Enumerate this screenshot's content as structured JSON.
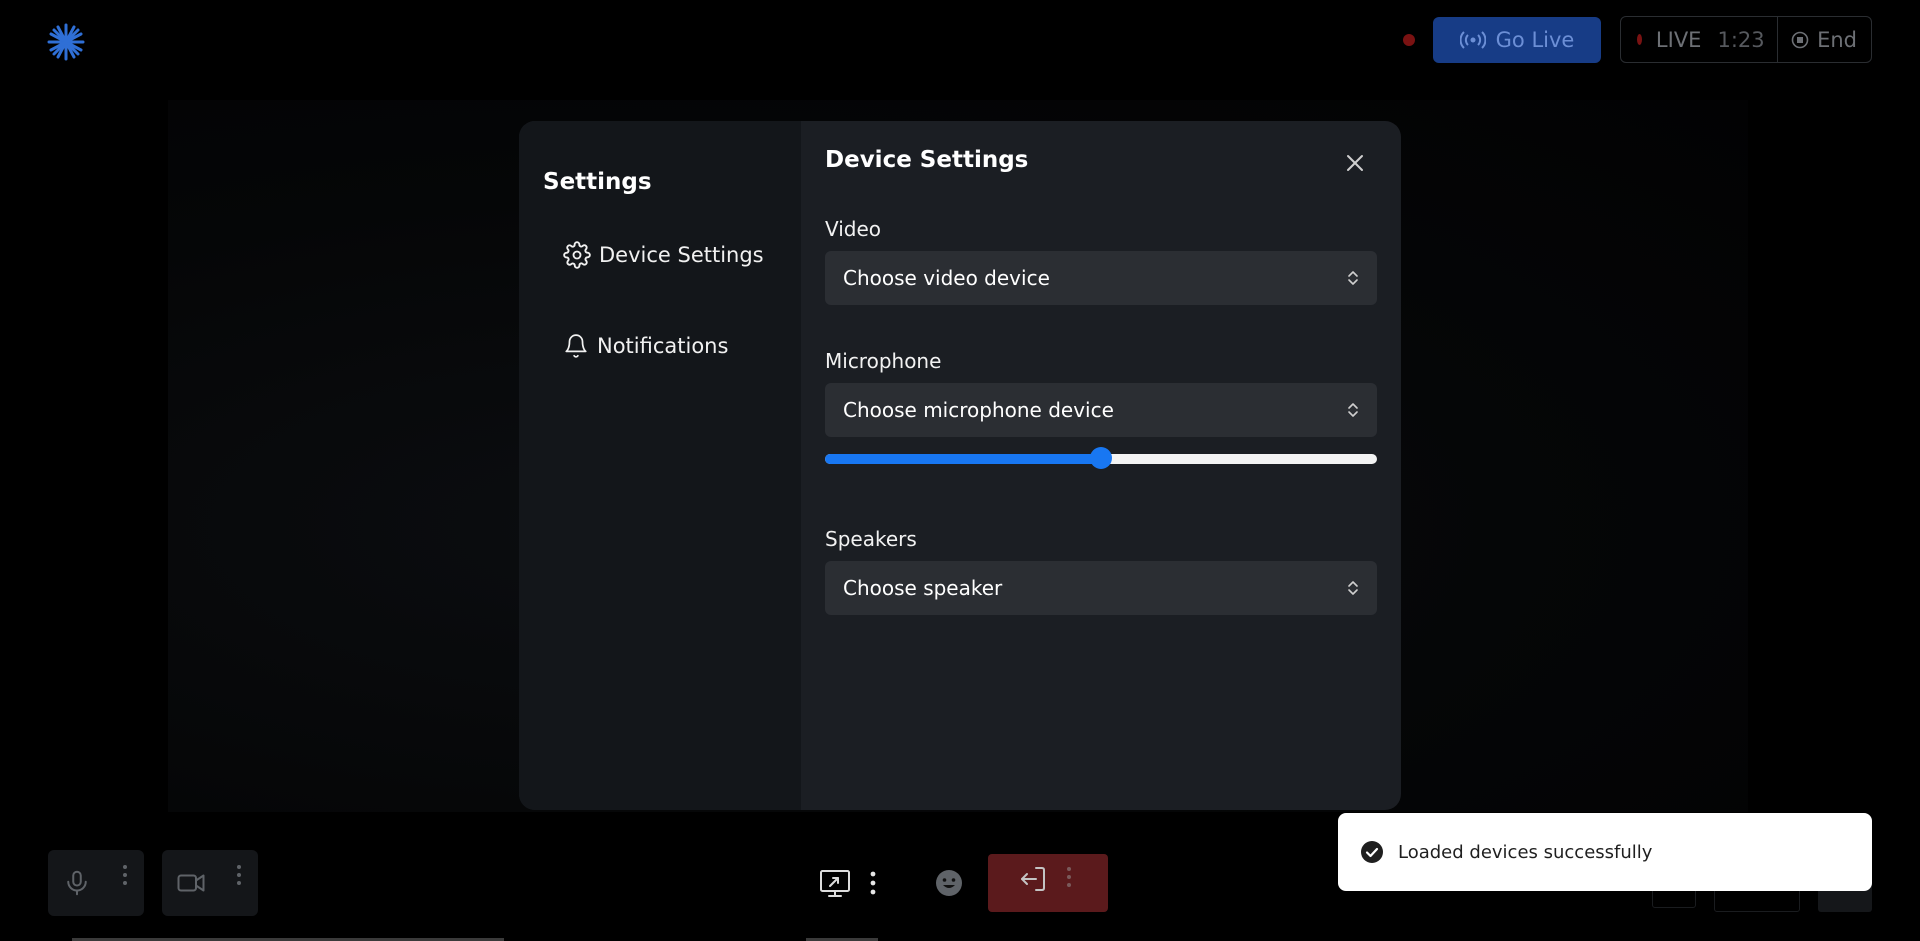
{
  "header": {
    "go_live_label": "Go Live",
    "live_label": "LIVE",
    "live_time": "1:23",
    "end_label": "End"
  },
  "settings": {
    "sidebar_title": "Settings",
    "nav": [
      {
        "label": "Device Settings",
        "icon": "gear-icon"
      },
      {
        "label": "Notifications",
        "icon": "bell-icon"
      }
    ],
    "main_title": "Device Settings",
    "video": {
      "label": "Video",
      "value": "Choose video device"
    },
    "microphone": {
      "label": "Microphone",
      "value": "Choose microphone device",
      "volume": 0.5
    },
    "speakers": {
      "label": "Speakers",
      "value": "Choose speaker"
    }
  },
  "toast": {
    "message": "Loaded devices successfully"
  },
  "colors": {
    "accent": "#1877f2",
    "go_live_bg": "#173c86",
    "leave_bg": "#5b1a1c",
    "modal_bg": "#1b1e23",
    "sidebar_bg": "#13161a"
  }
}
